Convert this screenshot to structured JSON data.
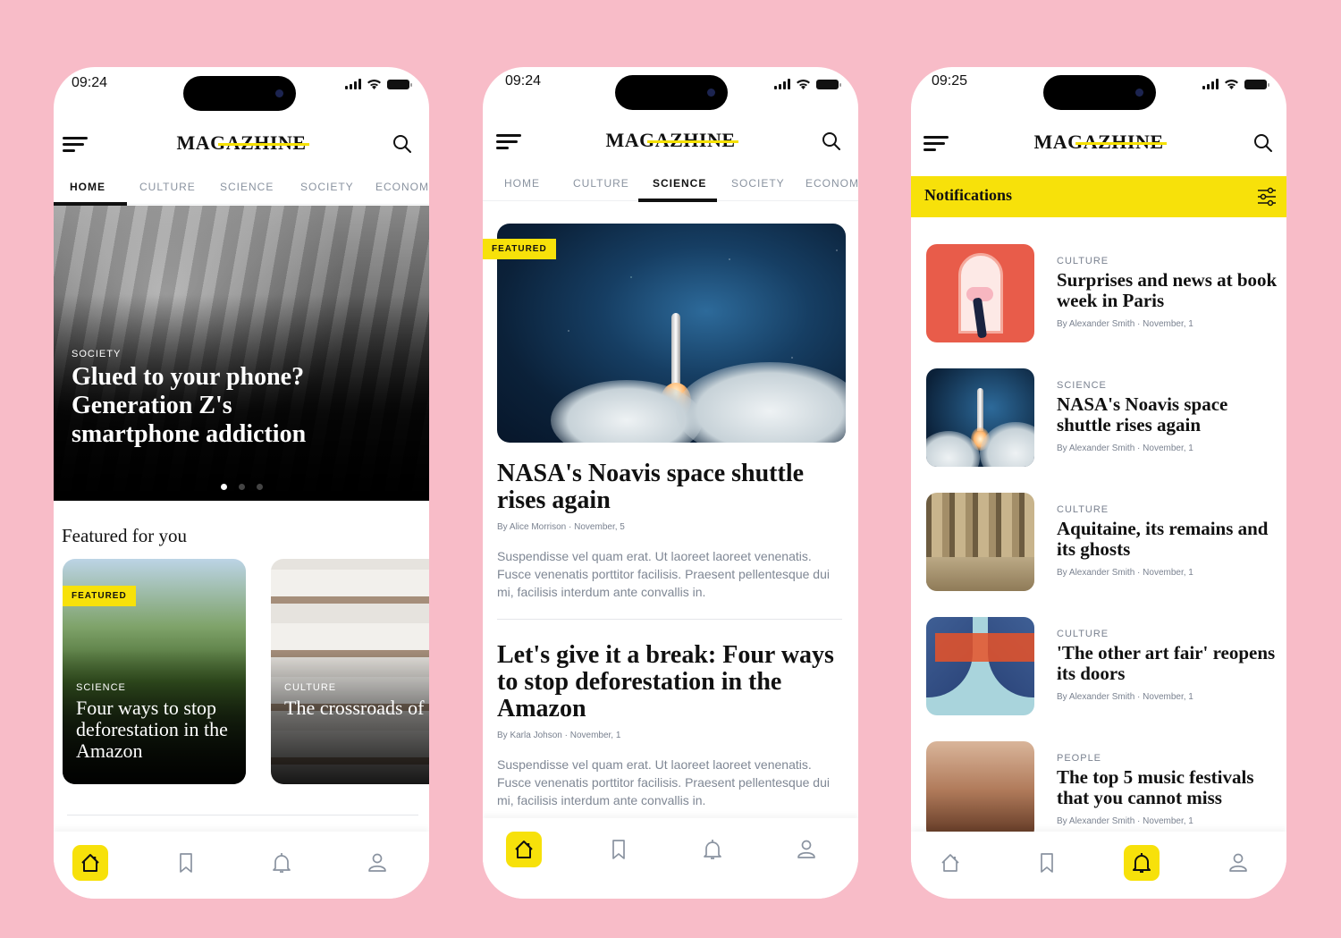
{
  "app": {
    "logo": "MAGAZHINE",
    "colors": {
      "accent": "#f7e10a",
      "background": "#f8bcc8",
      "text": "#111111",
      "muted": "#7a8290"
    }
  },
  "nav_tabs": [
    "HOME",
    "CULTURE",
    "SCIENCE",
    "SOCIETY",
    "ECONOMY"
  ],
  "bottom_nav": [
    {
      "icon": "home-icon",
      "label": "Home"
    },
    {
      "icon": "bookmark-icon",
      "label": "Saved"
    },
    {
      "icon": "bell-icon",
      "label": "Notifications"
    },
    {
      "icon": "user-icon",
      "label": "Profile"
    }
  ],
  "screens": [
    {
      "time": "09:24",
      "active_tab": "HOME",
      "hero": {
        "kicker": "SOCIETY",
        "title": "Glued to your phone? Generation Z's smartphone addiction",
        "slide": 1,
        "slides": 3
      },
      "section_title": "Featured for you",
      "cards": [
        {
          "tag": "FEATURED",
          "kicker": "SCIENCE",
          "title": "Four ways to stop deforestation in the Amazon"
        },
        {
          "kicker": "CULTURE",
          "title": "The crossroads of the largest library in the world"
        }
      ],
      "active_nav": "home"
    },
    {
      "time": "09:24",
      "active_tab": "SCIENCE",
      "featured_tag": "FEATURED",
      "articles": [
        {
          "title": "NASA's Noavis space shuttle rises again",
          "author": "By Alice Morrison",
          "date": "November, 5",
          "excerpt": "Suspendisse vel quam erat. Ut laoreet laoreet venenatis. Fusce venenatis porttitor facilisis. Praesent pellentesque dui mi, facilisis interdum ante convallis in."
        },
        {
          "title": "Let's give it a break: Four ways to stop deforestation in the Amazon",
          "author": "By Karla Johson",
          "date": "November, 1",
          "excerpt": "Suspendisse vel quam erat. Ut laoreet laoreet venenatis. Fusce venenatis porttitor facilisis. Praesent pellentesque dui mi, facilisis interdum ante convallis in."
        }
      ],
      "active_nav": "home"
    },
    {
      "time": "09:25",
      "header": "Notifications",
      "notifications": [
        {
          "kicker": "CULTURE",
          "title": "Surprises and news at book week in Paris",
          "author": "By Alexander Smith",
          "date": "November, 1"
        },
        {
          "kicker": "SCIENCE",
          "title": "NASA's Noavis space shuttle rises again",
          "author": "By Alexander Smith",
          "date": "November, 1"
        },
        {
          "kicker": "CULTURE",
          "title": "Aquitaine, its remains and its ghosts",
          "author": "By Alexander Smith",
          "date": "November, 1"
        },
        {
          "kicker": "CULTURE",
          "title": "'The other art fair' reopens its doors",
          "author": "By Alexander Smith",
          "date": "November, 1"
        },
        {
          "kicker": "PEOPLE",
          "title": "The top 5 music festivals that you cannot miss",
          "author": "By Alexander Smith",
          "date": "November, 1"
        }
      ],
      "active_nav": "notifications"
    }
  ]
}
